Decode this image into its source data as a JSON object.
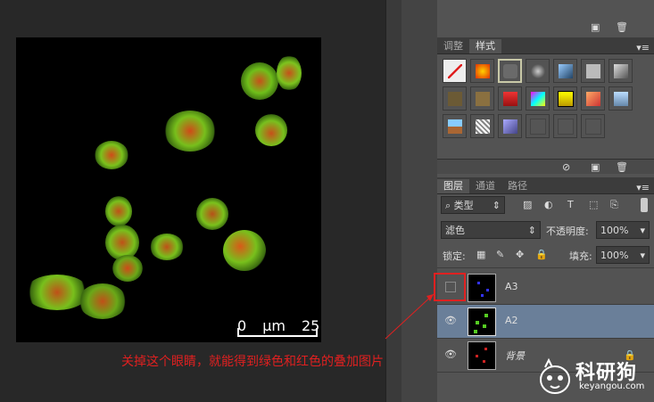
{
  "canvas": {
    "scalebar": {
      "start": "0",
      "unit": "μm",
      "end": "25"
    }
  },
  "styles_panel": {
    "tabs": [
      "调整",
      "样式"
    ],
    "active_tab": "样式",
    "menu_icon": "panel-menu-icon"
  },
  "layers_panel": {
    "tabs": [
      "图层",
      "通道",
      "路径"
    ],
    "active_tab": "图层",
    "filter_kind": "类型",
    "blend_mode": "滤色",
    "opacity_label": "不透明度:",
    "opacity_value": "100%",
    "lock_label": "锁定:",
    "fill_label": "填充:",
    "fill_value": "100%",
    "layers": [
      {
        "name": "A3",
        "visible": false,
        "selected": false
      },
      {
        "name": "A2",
        "visible": true,
        "selected": true
      },
      {
        "name": "背景",
        "visible": true,
        "selected": false,
        "locked": true
      }
    ]
  },
  "annotation": "关掉这个眼睛，就能得到绿色和红色的叠加图片",
  "watermark": {
    "name": "科研狗",
    "url": "keyangou.com"
  },
  "colors": {
    "panel_bg": "#535353",
    "selected_layer": "#6a7f99",
    "annotation": "#e02020"
  }
}
